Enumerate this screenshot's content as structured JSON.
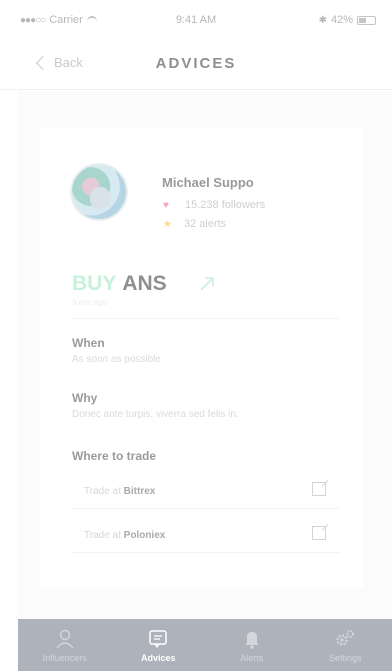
{
  "status_bar": {
    "carrier": "Carrier",
    "time": "9:41 AM",
    "battery": "42%"
  },
  "nav": {
    "back_label": "Back",
    "title": "ADVICES"
  },
  "influencer": {
    "name": "Michael Suppo",
    "followers": "15.238 followers",
    "alerts": "32 alerts"
  },
  "advice": {
    "action": "BUY",
    "ticker": "ANS",
    "time_ago": "3 min ago",
    "when_label": "When",
    "when_text": "As soon as possible",
    "why_label": "Why",
    "why_text": "Donec ante turpis, viverra sed felis in.",
    "where_label": "Where to trade",
    "exchanges": [
      {
        "prefix": "Trade at",
        "name": "Bittrex"
      },
      {
        "prefix": "Trade at",
        "name": "Poloniex"
      }
    ]
  },
  "tabs": [
    {
      "label": "Influencers",
      "icon": "person-icon",
      "active": false
    },
    {
      "label": "Advices",
      "icon": "chat-icon",
      "active": true
    },
    {
      "label": "Alerts",
      "icon": "bell-icon",
      "active": false
    },
    {
      "label": "Settings",
      "icon": "gears-icon",
      "active": false
    }
  ],
  "colors": {
    "buy": "#c8f0da",
    "tab_bar": "#aeb3bb",
    "heart": "#f3a6b4",
    "star": "#f6dd8e"
  }
}
